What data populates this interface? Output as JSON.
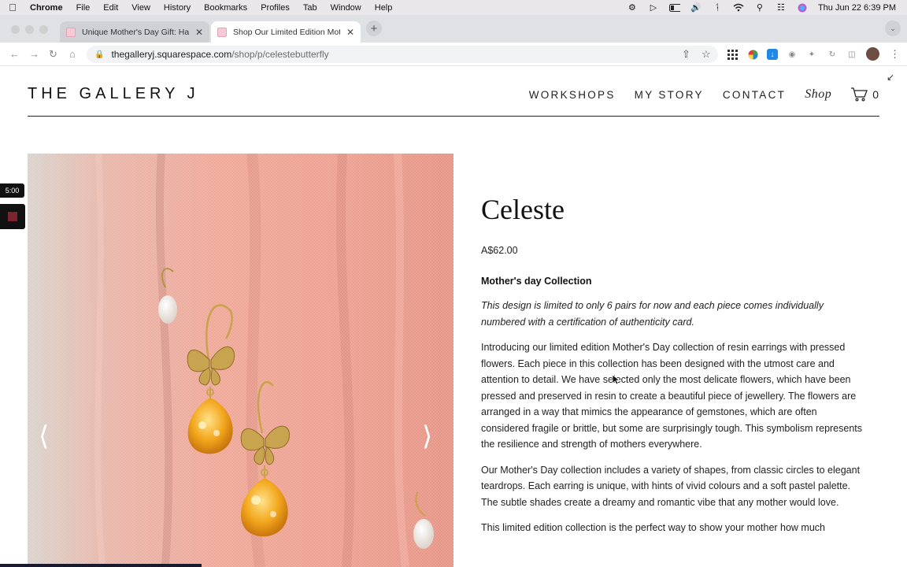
{
  "menubar": {
    "app": "Chrome",
    "items": [
      "File",
      "Edit",
      "View",
      "History",
      "Bookmarks",
      "Profiles",
      "Tab",
      "Window",
      "Help"
    ],
    "clock": "Thu Jun 22  6:39 PM"
  },
  "tabs": [
    {
      "title": "Unique Mother's Day Gift: Han",
      "active": false
    },
    {
      "title": "Shop Our Limited Edition Moth",
      "active": true
    }
  ],
  "address": {
    "host": "thegalleryj.squarespace.com",
    "path": "/shop/p/celestebutterfly"
  },
  "site": {
    "logo": "THE GALLERY J",
    "nav": [
      "WORKSHOPS",
      "MY STORY",
      "CONTACT"
    ],
    "shop_label": "Shop",
    "cart_count": "0"
  },
  "widget": {
    "timer": "5:00"
  },
  "product": {
    "title": "Celeste",
    "price": "A$62.00",
    "collection": "Mother's day Collection",
    "italic_note": "This design is limited to only 6 pairs for now and each piece comes individually numbered with a certification of authenticity card.",
    "para1": "Introducing our limited edition Mother's Day collection of resin earrings with pressed flowers. Each piece in this collection has been designed with the utmost care and attention to detail. We have selected only the most delicate flowers, which have been pressed and preserved in resin to create a beautiful piece of jewellery. The flowers are arranged in a way that mimics the appearance of gemstones, which are often considered fragile or brittle, but some are surprisingly tough. This symbolism represents the resilience and strength of mothers everywhere.",
    "para2": "Our Mother's Day collection includes a variety of shapes, from classic circles to elegant teardrops. Each earring is unique, with hints of vivid colours and a soft pastel palette. The subtle shades create a dreamy and romantic vibe that any mother would love.",
    "para3": "This limited edition collection is the perfect way to show your mother how much"
  },
  "colors": {
    "accent": "#111111",
    "fabric": "#e9a898",
    "resin": "#f0a21a"
  }
}
